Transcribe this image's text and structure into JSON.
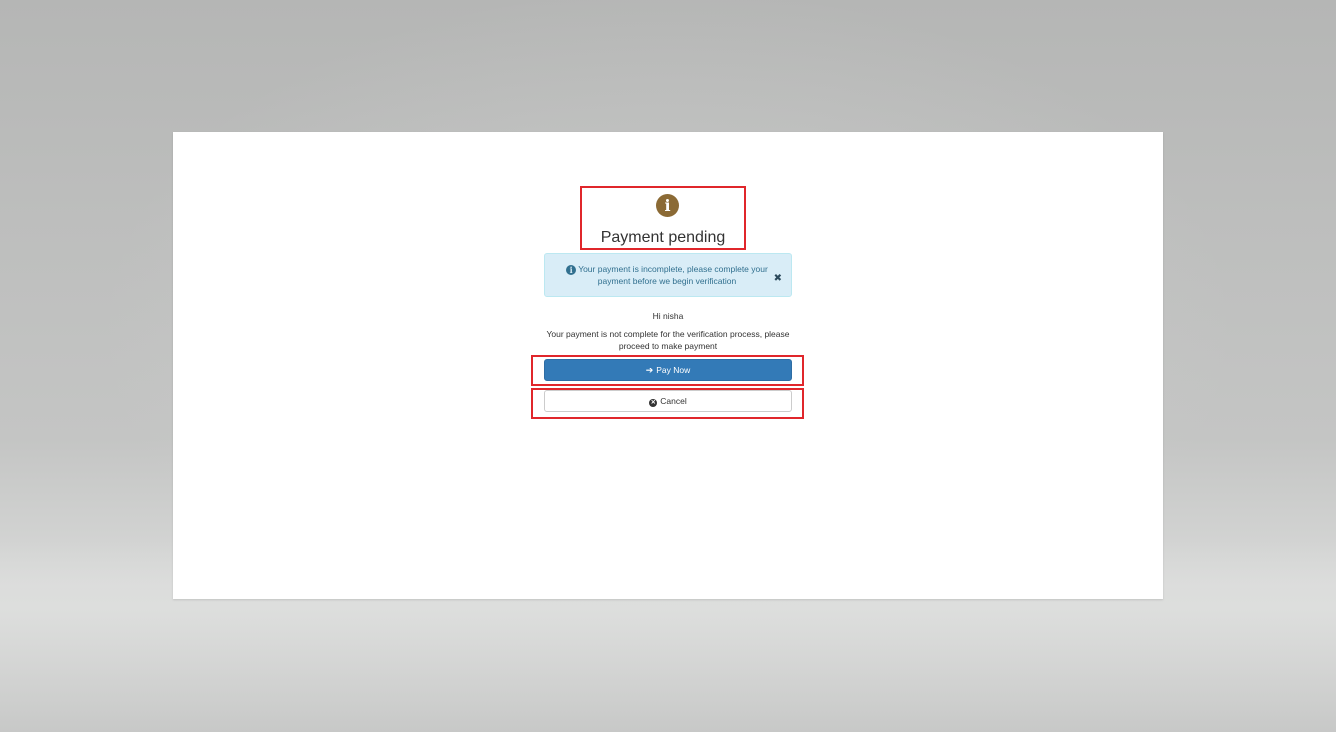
{
  "header": {
    "icon": "info-circle-icon",
    "icon_glyph": "i",
    "title": "Payment pending"
  },
  "alert": {
    "icon": "info-circle-icon",
    "icon_glyph": "i",
    "message": "Your payment is incomplete, please complete your payment before we begin verification",
    "close_glyph": "✖"
  },
  "body": {
    "greeting": "Hi nisha",
    "message": "Your payment is not complete for the verification process, please proceed to make payment"
  },
  "actions": {
    "pay_icon": "arrow-right-icon",
    "pay_icon_glyph": "➔",
    "pay_label": "Pay Now",
    "cancel_icon": "times-circle-icon",
    "cancel_icon_glyph": "✕",
    "cancel_label": "Cancel"
  },
  "colors": {
    "primary": "#337ab7",
    "alert_bg": "#d9edf7",
    "alert_text": "#31708f",
    "header_icon": "#8b6a35",
    "annotation_outline": "#e0262b"
  }
}
